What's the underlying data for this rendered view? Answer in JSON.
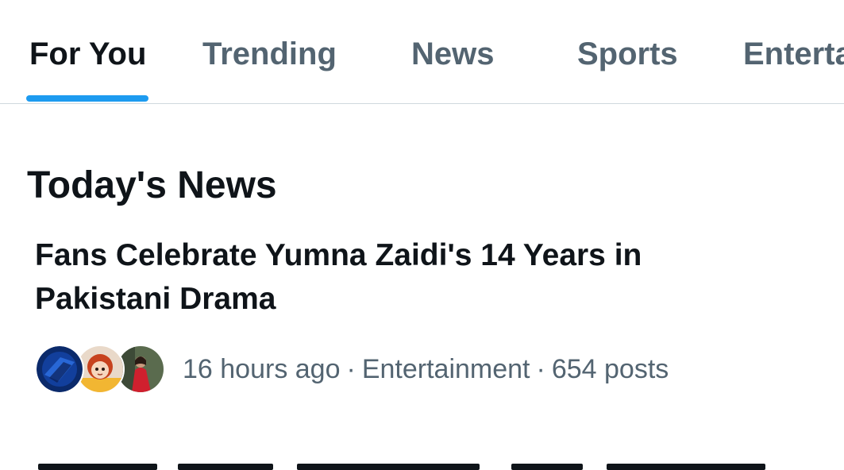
{
  "tabs": [
    {
      "label": "For You",
      "active": true
    },
    {
      "label": "Trending",
      "active": false
    },
    {
      "label": "News",
      "active": false
    },
    {
      "label": "Sports",
      "active": false
    },
    {
      "label": "Entertainment",
      "active": false
    }
  ],
  "section": {
    "title": "Today's News"
  },
  "story": {
    "headline": "Fans Celebrate Yumna Zaidi's 14 Years in Pakistani Drama",
    "time": "16 hours ago",
    "category": "Entertainment",
    "posts": "654 posts",
    "separator": "·",
    "avatars": [
      "news-logo-avatar",
      "cartoon-girl-avatar",
      "woman-in-red-avatar"
    ]
  },
  "colors": {
    "accent": "#1d9bf0",
    "text_primary": "#0f1419",
    "text_secondary": "#536471",
    "divider": "#cfd9de"
  }
}
